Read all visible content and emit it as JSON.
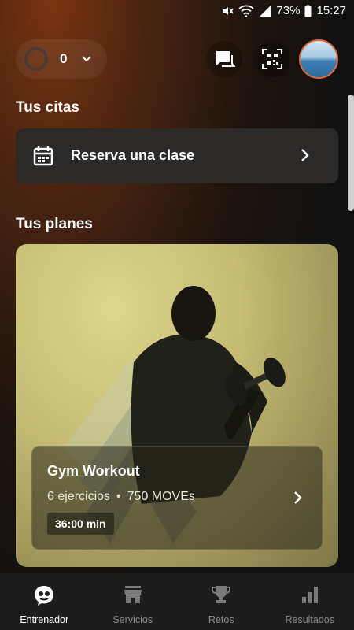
{
  "status_bar": {
    "battery": "73%",
    "time": "15:27"
  },
  "header": {
    "moves_count": "0"
  },
  "appointments": {
    "title": "Tus citas",
    "reserve_label": "Reserva una clase"
  },
  "plans": {
    "title": "Tus planes",
    "card": {
      "name": "Gym Workout",
      "exercises": "6 ejercicios",
      "separator": "•",
      "moves": "750 MOVEs",
      "duration": "36:00 min"
    }
  },
  "bottom_nav": [
    {
      "label": "Entrenador",
      "icon": "coach-icon",
      "active": true
    },
    {
      "label": "Servicios",
      "icon": "store-icon",
      "active": false
    },
    {
      "label": "Retos",
      "icon": "trophy-icon",
      "active": false
    },
    {
      "label": "Resultados",
      "icon": "bar-chart-icon",
      "active": false
    }
  ]
}
